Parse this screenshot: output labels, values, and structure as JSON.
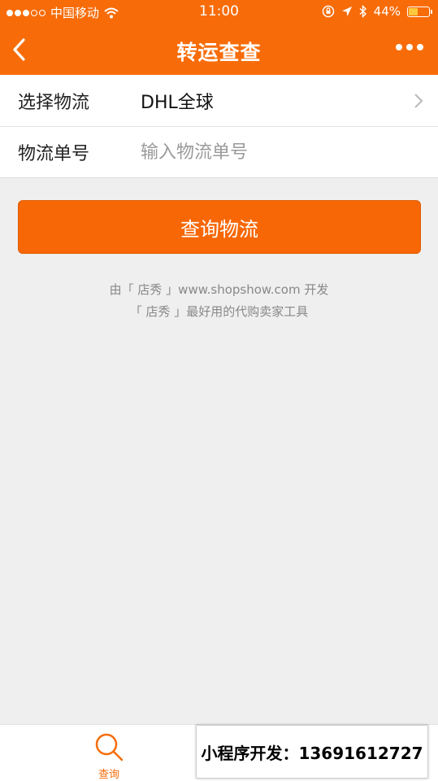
{
  "status_bar": {
    "carrier": "中国移动",
    "time": "11:00",
    "battery": "44%",
    "battery_level": 0.44
  },
  "nav": {
    "title": "转运查查"
  },
  "form": {
    "logistics_label": "选择物流",
    "logistics_value": "DHL全球",
    "tracking_label": "物流单号",
    "tracking_placeholder": "输入物流单号",
    "tracking_value": ""
  },
  "actions": {
    "query_label": "查询物流"
  },
  "footer": {
    "line1": "由「 店秀 」www.shopshow.com 开发",
    "line2": "「 店秀 」最好用的代购卖家工具"
  },
  "tab_bar": {
    "query_label": "查询"
  },
  "promo": {
    "text": "小程序开发：13691612727"
  },
  "colors": {
    "brand": "#f76c09",
    "background": "#efefef"
  }
}
